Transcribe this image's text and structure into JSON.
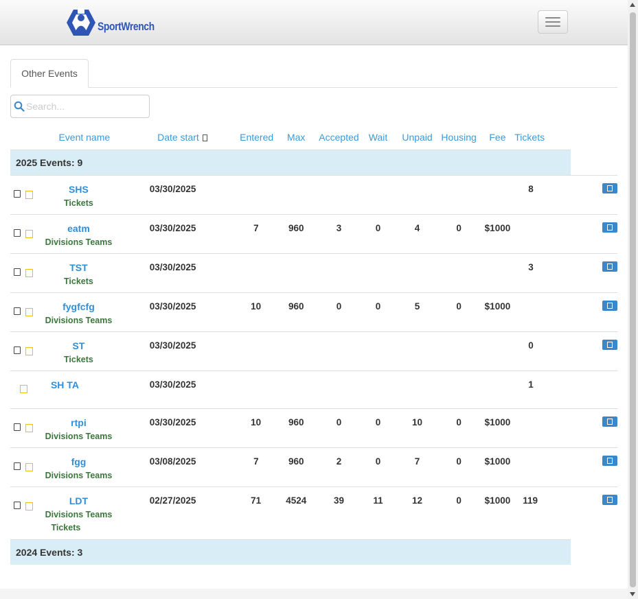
{
  "brand": {
    "name": "SportWrench",
    "color": "#2f55b5"
  },
  "tabs": [
    {
      "label": "Other Events"
    }
  ],
  "search": {
    "placeholder": "Search...",
    "value": ""
  },
  "columns": {
    "event_name": "Event name",
    "date_start": "Date start",
    "entered": "Entered",
    "max": "Max",
    "accepted": "Accepted",
    "wait": "Wait",
    "unpaid": "Unpaid",
    "housing": "Housing",
    "fee": "Fee",
    "tickets": "Tickets"
  },
  "groups": [
    {
      "label": "2025 Events: 9",
      "events": [
        {
          "name": "SHS",
          "links": [
            "Tickets"
          ],
          "date": "03/30/2025",
          "entered": "",
          "max": "",
          "accepted": "",
          "wait": "",
          "unpaid": "",
          "housing": "",
          "fee": "",
          "tickets": "8"
        },
        {
          "name": "eatm",
          "links": [
            "Divisions Teams"
          ],
          "date": "03/30/2025",
          "entered": "7",
          "max": "960",
          "accepted": "3",
          "wait": "0",
          "unpaid": "4",
          "housing": "0",
          "fee": "$1000",
          "tickets": ""
        },
        {
          "name": "TST",
          "links": [
            "Tickets"
          ],
          "date": "03/30/2025",
          "entered": "",
          "max": "",
          "accepted": "",
          "wait": "",
          "unpaid": "",
          "housing": "",
          "fee": "",
          "tickets": "3"
        },
        {
          "name": "fygfcfg",
          "links": [
            "Divisions Teams"
          ],
          "date": "03/30/2025",
          "entered": "10",
          "max": "960",
          "accepted": "0",
          "wait": "0",
          "unpaid": "5",
          "housing": "0",
          "fee": "$1000",
          "tickets": ""
        },
        {
          "name": "ST",
          "links": [
            "Tickets"
          ],
          "date": "03/30/2025",
          "entered": "",
          "max": "",
          "accepted": "",
          "wait": "",
          "unpaid": "",
          "housing": "",
          "fee": "",
          "tickets": "0"
        },
        {
          "name": "SH TA",
          "links": [],
          "date": "03/30/2025",
          "entered": "",
          "max": "",
          "accepted": "",
          "wait": "",
          "unpaid": "",
          "housing": "",
          "fee": "",
          "tickets": "1"
        },
        {
          "name": "rtpi",
          "links": [
            "Divisions Teams"
          ],
          "date": "03/30/2025",
          "entered": "10",
          "max": "960",
          "accepted": "0",
          "wait": "0",
          "unpaid": "10",
          "housing": "0",
          "fee": "$1000",
          "tickets": ""
        },
        {
          "name": "fgg",
          "links": [
            "Divisions Teams"
          ],
          "date": "03/08/2025",
          "entered": "7",
          "max": "960",
          "accepted": "2",
          "wait": "0",
          "unpaid": "7",
          "housing": "0",
          "fee": "$1000",
          "tickets": ""
        },
        {
          "name": "LDT",
          "links": [
            "Divisions Teams",
            "Tickets"
          ],
          "date": "02/27/2025",
          "entered": "71",
          "max": "4524",
          "accepted": "39",
          "wait": "11",
          "unpaid": "12",
          "housing": "0",
          "fee": "$1000",
          "tickets": "119"
        }
      ]
    },
    {
      "label": "2024 Events: 3",
      "events": []
    }
  ]
}
